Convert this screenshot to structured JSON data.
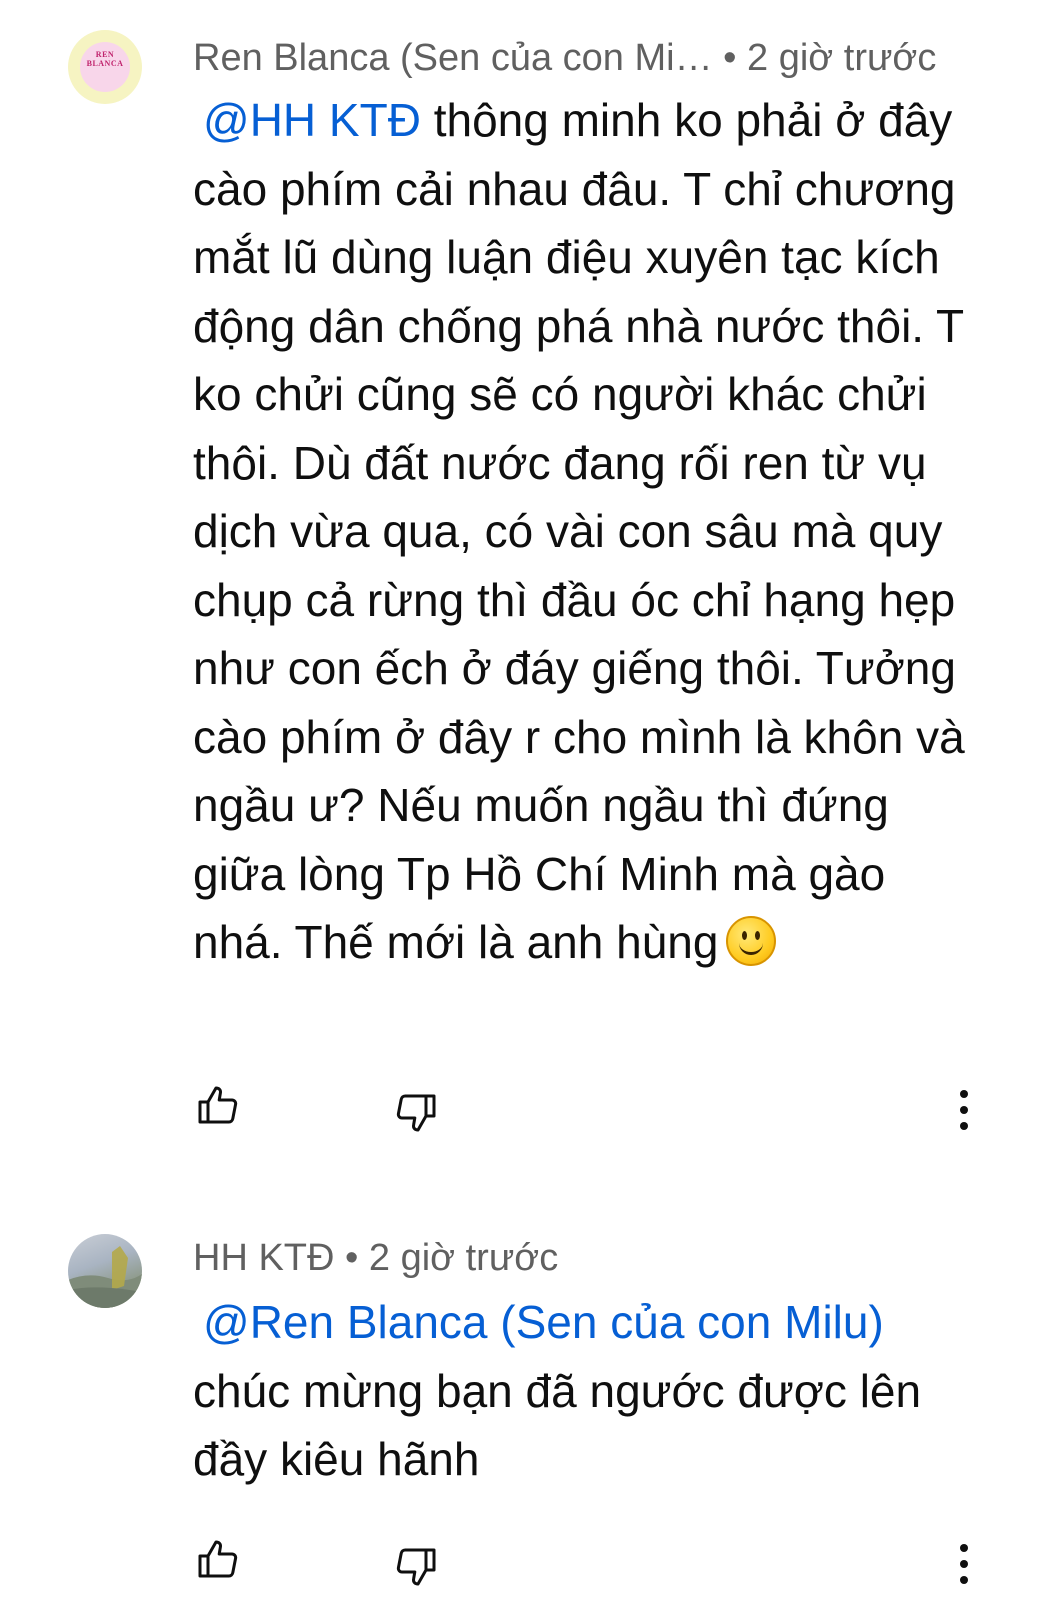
{
  "comments": [
    {
      "author": "Ren Blanca (Sen của con Mi…",
      "time": "• 2 giờ trước",
      "avatar_icon": "ren-blanca-avatar",
      "avatar_text_line1": "REN",
      "avatar_text_line2": "BLANCA",
      "mention": "@HH KTĐ",
      "text": " thông minh ko phải ở đây cào phím cải nhau đâu. T chỉ chương mắt lũ dùng luận điệu xuyên tạc kích động dân chống phá nhà nước thôi. T ko chửi cũng sẽ có người khác chửi thôi. Dù đất nước đang rối ren từ vụ dịch vừa qua, có vài con sâu mà quy chụp cả rừng thì đầu óc chỉ hạng hẹp như con ếch ở đáy giếng thôi. Tưởng cào phím ở đây r cho mình là khôn và ngầu ư? Nếu muốn ngầu thì đứng giữa lòng Tp Hồ Chí Minh mà gào nhá. Thế mới là anh hùng",
      "emoji": "smiling-face-emoji"
    },
    {
      "author": "HH KTĐ",
      "time": "• 2 giờ trước",
      "avatar_icon": "landscape-avatar",
      "mention": "@Ren Blanca (Sen của con Milu)",
      "text": "chúc mừng bạn đã ngước được lên đầy kiêu hãnh"
    }
  ],
  "icons": {
    "like": "thumbs-up-icon",
    "dislike": "thumbs-down-icon",
    "more": "more-vert-icon"
  },
  "colors": {
    "mention": "#065fd4",
    "meta": "#606060",
    "text": "#0f0f0f"
  }
}
